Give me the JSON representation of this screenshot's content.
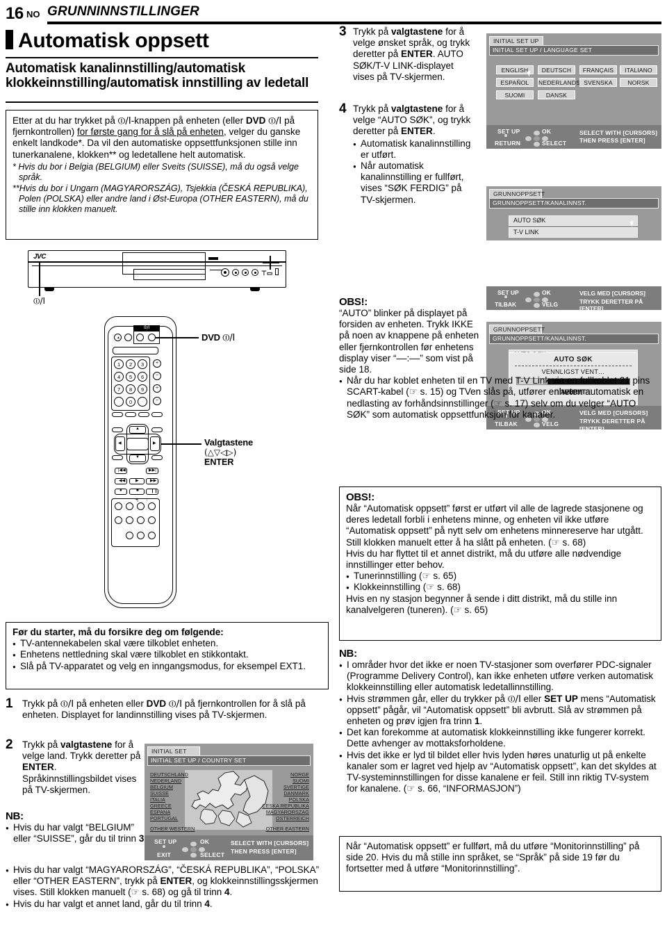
{
  "header": {
    "page_number": "16",
    "lang_code": "NO",
    "section_title": "GRUNNINNSTILLINGER"
  },
  "titles": {
    "main": "Automatisk oppsett",
    "sub": "Automatisk kanalinnstilling/automatisk klokkeinnstilling/automatisk innstilling av ledetall"
  },
  "intro_box": {
    "p1_a": "Etter at du har trykket på ",
    "p1_power": "⏼/I",
    "p1_b": "-knappen på enheten (eller ",
    "p1_dvd": "DVD",
    "p1_c": " ",
    "p1_power2": "⏼/I",
    "p1_d": " på fjernkontrollen) ",
    "p1_underline": "for første gang for å slå på enheten",
    "p1_e": ", velger du ganske enkelt landkode*. Da vil den automatiske oppsettfunksjonen stille inn tunerkanalene, klokken** og ledetallene helt automatisk.",
    "note1": "* Hvis du bor i Belgia (BELGIUM) eller Sveits (SUISSE), må du også velge språk.",
    "note2": "**Hvis du bor i Ungarn (MAGYARORSZÁG), Tsjekkia (ČESKÁ REPUBLIKA), Polen (POLSKA) eller andre land i Øst-Europa (OTHER EASTERN), må du stille inn klokken manuelt."
  },
  "hardware": {
    "brand": "JVC",
    "deck_power_label": "⏼/I",
    "remote_dvd_label_bold": "DVD",
    "remote_dvd_label_sym": "⏼/I",
    "remote_power_strip": "⏼/I",
    "numbers": [
      "1",
      "2",
      "3",
      "4",
      "5",
      "6",
      "7",
      "8",
      "9",
      "0"
    ],
    "plus": "+",
    "minus": "−",
    "cursor_callout_1": "Valgtastene",
    "cursor_callout_2": "(△▽◁▷)",
    "cursor_callout_3": "ENTER"
  },
  "before_box": {
    "title": "Før du starter, må du forsikre deg om følgende:",
    "items": [
      "TV-antennekabelen skal være tilkoblet enheten.",
      "Enhetens nettledning skal være tilkoblet en stikkontakt.",
      "Slå på TV-apparatet og velg en inngangsmodus, for eksempel EXT1."
    ]
  },
  "steps": {
    "s1": {
      "num": "1",
      "text_a": "Trykk på ",
      "pw": "⏼/I",
      "text_b": " på enheten eller ",
      "dvd": "DVD",
      "pw2": "⏼/I",
      "text_c": " på fjernkontrollen for å slå på enheten. Displayet for landinnstilling vises på TV-skjermen."
    },
    "s2": {
      "num": "2",
      "a": "Trykk på ",
      "bold1": "valgtastene",
      "b": " for å velge land. Trykk deretter på ",
      "bold2": "ENTER",
      "c": ". Språkinnstillingsbildet vises på TV-skjermen.",
      "nb": "NB:",
      "b1_a": "Hvis du har valgt “BELGIUM” eller “SUISSE”, går du til trinn ",
      "b1_bold": "3",
      "b1_b": ".",
      "b2_a": "Hvis du har valgt “MAGYARORSZÁG”, “ČESKÁ REPUBLIKA”, “POLSKA” eller “OTHER EASTERN”, trykk på ",
      "b2_bold": "ENTER",
      "b2_b": ", og klokkeinnstillingsskjermen vises. Still klokken manuelt (☞ s. 68) og gå til trinn ",
      "b2_bold2": "4",
      "b2_c": ".",
      "b3_a": "Hvis du har valgt et annet land, går du til trinn ",
      "b3_bold": "4",
      "b3_b": "."
    },
    "s3": {
      "num": "3",
      "a": "Trykk på ",
      "bold1": "valgtastene",
      "b": " for å velge ønsket språk, og trykk deretter på ",
      "bold2": "ENTER",
      "c": ". AUTO SØK/T-V LINK-displayet vises på TV-skjermen."
    },
    "s4": {
      "num": "4",
      "a": "Trykk på ",
      "bold1": "valgtastene",
      "b": " for å velge “AUTO SØK”, og trykk deretter på ",
      "bold2": "ENTER",
      "c": ".",
      "bullet1": "Automatisk kanalinnstilling er utført.",
      "bullet2": "Når automatisk kanalinnstilling er fullført, vises “SØK FERDIG” på TV-skjermen."
    }
  },
  "obs1": {
    "title": "OBS!:",
    "p1": "“AUTO” blinker på displayet på forsiden av enheten. Trykk IKKE på noen av knappene på enheten eller fjernkontrollen før enhetens display viser “––:––” som vist på side 18.",
    "bullet": "Når du har koblet enheten til en TV med T-V Link via en fullkoblet 21 pins SCART-kabel (☞ s. 15) og TVen slås på, utfører enheten automatisk en nedlasting av forhåndsinnstillinger (☞ s. 17) selv om du velger “AUTO SØK” som automatisk oppsettfunksjon for kanaler."
  },
  "obs2": {
    "title": "OBS!:",
    "p1": "Når “Automatisk oppsett” først er utført vil alle de lagrede stasjonene og deres ledetall forbli i enhetens minne, og enheten vil ikke utføre “Automatisk oppsett” på nytt selv om enhetens minnereserve har utgått. Still klokken manuelt etter å ha slått på enheten. (☞ s. 68)",
    "p2": "Hvis du har flyttet til et annet distrikt, må du utføre alle nødvendige innstillinger etter behov.",
    "b1": "Tunerinnstilling (☞ s. 65)",
    "b2": "Klokkeinnstilling (☞ s. 68)",
    "p3": "Hvis en ny stasjon begynner å sende i ditt distrikt, må du stille inn kanalvelgeren (tuneren). (☞ s. 65)"
  },
  "nb_right": {
    "title": "NB:",
    "b1": "I områder hvor det ikke er noen TV-stasjoner som overfører PDC-signaler (Programme Delivery Control), kan ikke enheten utføre verken automatisk klokkeinnstilling eller automatisk ledetallinnstilling.",
    "b2_a": "Hvis strømmen går, eller du trykker på ",
    "b2_pw": "⏼/I",
    "b2_b": " eller ",
    "b2_bold": "SET UP",
    "b2_c": " mens “Automatisk oppsett” pågår, vil “Automatisk oppsett” bli avbrutt. Slå av strømmen på enheten og prøv igjen fra trinn ",
    "b2_bold2": "1",
    "b2_d": ".",
    "b3": "Det kan forekomme at automatisk klokkeinnstilling ikke fungerer korrekt. Dette avhenger av mottaksforholdene.",
    "b4": "Hvis det ikke er lyd til bildet eller hvis lyden høres unaturlig ut på enkelte kanaler som er lagret ved hjelp av “Automatisk oppsett”, kan det skyldes at TV-systeminnstillingen for disse kanalene er feil. Still inn riktig TV-system for kanalene. (☞ s. 66, “INFORMASJON”)"
  },
  "final_box": {
    "text": "Når “Automatisk oppsett” er fullført, må du utføre “Monitorinnstilling” på side 20. Hvis du må stille inn språket, se “Språk” på side 19 før du fortsetter med å utføre “Monitorinnstilling”."
  },
  "screens": {
    "language": {
      "tab": "INITIAL SET UP",
      "bar": "INITIAL SET UP / LANGUAGE SET",
      "buttons": [
        "ENGLISH",
        "DEUTSCH",
        "FRANÇAIS",
        "ITALIANO",
        "ESPAÑOL",
        "NEDERLANDS",
        "SVENSKA",
        "NORSK",
        "SUOMI",
        "DANSK"
      ],
      "foot_setup": "SET UP",
      "foot_return": "RETURN",
      "foot_ok": "OK",
      "foot_select": "SELECT",
      "foot_right1": "SELECT WITH [CURSORS]",
      "foot_right2": "THEN PRESS [ENTER]"
    },
    "autosok": {
      "tab": "GRUNNOPPSETT",
      "bar": "GRUNNOPPSETT/KANALINNST.",
      "rows": [
        "AUTO SØK",
        "T-V LINK"
      ]
    },
    "foot_norsk_a": {
      "setup": "SET UP",
      "tilbak": "TILBAK",
      "ok": "OK",
      "velg": "VELG",
      "r1": "VELG MED [CURSORS]",
      "r2": "TRYKK DERETTER PÅ [ENTER]"
    },
    "wait": {
      "tab": "GRUNNOPPSETT",
      "bar": "GRUNNOPPSETT/KANALINNST.",
      "behind_row": "AUTO SØK",
      "dlg_title": "AUTO SØK",
      "dlg_msg": "VENNLIGST VENT…",
      "dlg_btn": "AVBRYT",
      "setup": "SET UP",
      "tilbak": "TILBAK",
      "ok": "OK",
      "velg": "VELG",
      "r1": "VELG MED [CURSORS]",
      "r2": "TRYKK DERETTER PÅ [ENTER]"
    },
    "country": {
      "tab": "INITIAL SET UP",
      "bar": "INITIAL SET UP / COUNTRY SET",
      "left": [
        "DEUTSCHLAND",
        "NEDERLAND",
        "BELGIUM",
        "SUISSE",
        "ITALIA",
        "GREECE",
        "ESPANA",
        "PORTUGAL"
      ],
      "left_other": "OTHER WESTERN",
      "right": [
        "NORGE",
        "SUOMI",
        "SVERTIGE",
        "DANMARK",
        "POLSKA",
        "CESKA REPUBLIKA",
        "MAGYARORSZAG",
        "OSTERREICH"
      ],
      "right_other": "OTHER EASTERN",
      "foot_setup": "SET UP",
      "foot_exit": "EXIT",
      "foot_ok": "OK",
      "foot_select": "SELECT",
      "foot_right1": "SELECT WITH [CURSORS]",
      "foot_right2": "THEN PRESS [ENTER]"
    }
  },
  "colors": {
    "screen_bg": "#9a9a9a",
    "screen_footer": "#7d7d7d",
    "screen_bar": "#6e6e6e",
    "button_face": "#d8d8d8"
  }
}
